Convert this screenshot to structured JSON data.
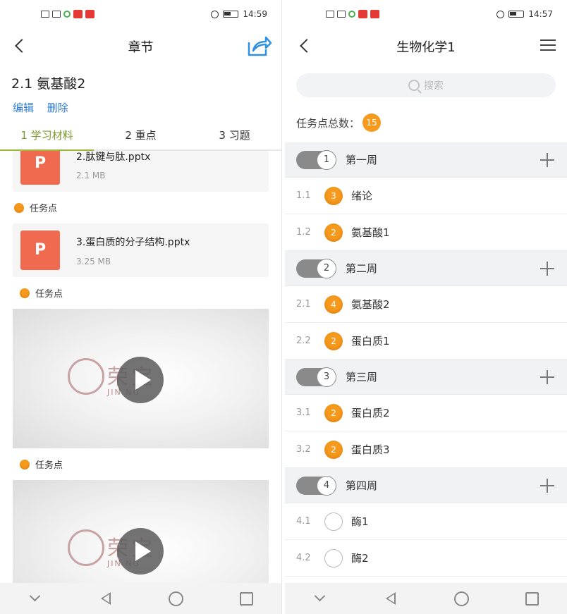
{
  "left": {
    "status": {
      "time": "14:59"
    },
    "header": {
      "title": "章节"
    },
    "chapter": {
      "title": "2.1 氨基酸2",
      "edit_label": "编辑",
      "delete_label": "删除"
    },
    "tabs": [
      "1 学习材料",
      "2 重点",
      "3 习题"
    ],
    "files": [
      {
        "name": "2.肽键与肽.pptx",
        "size": "2.1 MB",
        "icon": "ppt-icon"
      },
      {
        "name": "3.蛋白质的分子结构.pptx",
        "size": "3.25 MB",
        "icon": "ppt-icon"
      }
    ],
    "task_label": "任务点",
    "ppt_glyph": "P",
    "video_logo_text": "荣宝",
    "video_logo_sub": "JIN  NG"
  },
  "right": {
    "status": {
      "time": "14:57"
    },
    "header": {
      "title": "生物化学1"
    },
    "search": {
      "placeholder": "搜索"
    },
    "task_total": {
      "label": "任务点总数：",
      "count": "15"
    },
    "weeks": [
      {
        "num": "1",
        "label": "第一周",
        "lessons": [
          {
            "num": "1.1",
            "badge": "3",
            "title": "绪论"
          },
          {
            "num": "1.2",
            "badge": "2",
            "title": "氨基酸1"
          }
        ]
      },
      {
        "num": "2",
        "label": "第二周",
        "lessons": [
          {
            "num": "2.1",
            "badge": "4",
            "title": "氨基酸2"
          },
          {
            "num": "2.2",
            "badge": "2",
            "title": "蛋白质1"
          }
        ]
      },
      {
        "num": "3",
        "label": "第三周",
        "lessons": [
          {
            "num": "3.1",
            "badge": "2",
            "title": "蛋白质2"
          },
          {
            "num": "3.2",
            "badge": "2",
            "title": "蛋白质3"
          }
        ]
      },
      {
        "num": "4",
        "label": "第四周",
        "lessons": [
          {
            "num": "4.1",
            "badge": "",
            "title": "酶1"
          },
          {
            "num": "4.2",
            "badge": "",
            "title": "酶2"
          }
        ]
      }
    ]
  },
  "colors": {
    "accent_orange": "#f59a1c",
    "tab_active": "#7a9a2e",
    "link_blue": "#2f7bd6",
    "ppt_red": "#f06a4f"
  }
}
